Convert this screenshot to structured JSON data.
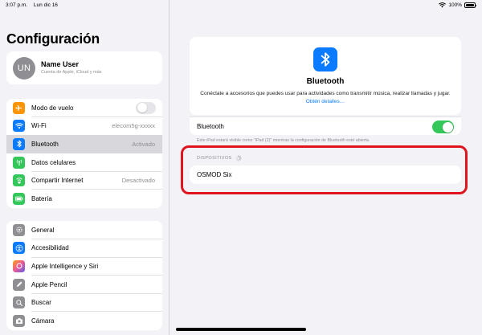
{
  "status_bar": {
    "time": "3:07 p.m.",
    "date": "Lun dic 16",
    "battery": "100%"
  },
  "sidebar": {
    "title": "Configuración",
    "profile": {
      "initials": "UN",
      "name": "Name User",
      "subtitle": "Cuenta de Apple, iCloud y más"
    },
    "group1": [
      {
        "label": "Modo de vuelo",
        "icon": "airplane-icon",
        "color": "#ff9500",
        "control": "toggle-off"
      },
      {
        "label": "Wi-Fi",
        "icon": "wifi-icon",
        "color": "#0a7aff",
        "value": "elecom5g-xxxxx"
      },
      {
        "label": "Bluetooth",
        "icon": "bluetooth-icon",
        "color": "#0a7aff",
        "value": "Activado",
        "selected": true
      },
      {
        "label": "Datos celulares",
        "icon": "cellular-icon",
        "color": "#34c759"
      },
      {
        "label": "Compartir Internet",
        "icon": "hotspot-icon",
        "color": "#34c759",
        "value": "Desactivado"
      },
      {
        "label": "Batería",
        "icon": "battery-icon",
        "color": "#34c759"
      }
    ],
    "group2": [
      {
        "label": "General",
        "icon": "gear-icon",
        "color": "#8e8e93"
      },
      {
        "label": "Accesibilidad",
        "icon": "accessibility-icon",
        "color": "#0a7aff"
      },
      {
        "label": "Apple Intelligence y Siri",
        "icon": "siri-icon",
        "color": "#e95a9b"
      },
      {
        "label": "Apple Pencil",
        "icon": "pencil-icon",
        "color": "#8e8e93"
      },
      {
        "label": "Buscar",
        "icon": "search-icon",
        "color": "#8e8e93"
      },
      {
        "label": "Cámara",
        "icon": "camera-icon",
        "color": "#8e8e93"
      }
    ]
  },
  "detail": {
    "title": "Bluetooth",
    "description": "Conéctate a accesorios que puedes usar para actividades como transmitir música, realizar llamadas y jugar.",
    "learn_more": "Obtén detalles…",
    "toggle_label": "Bluetooth",
    "toggle_on": true,
    "footnote": "Este iPad estará visible como \"iPad (2)\" mientras la configuración de Bluetooth esté abierta.",
    "devices_header": "DISPOSITIVOS",
    "devices": [
      "OSMOD Six"
    ],
    "highlight_color": "#e0141e",
    "accent_color": "#0a7aff",
    "toggle_color": "#34c759"
  }
}
